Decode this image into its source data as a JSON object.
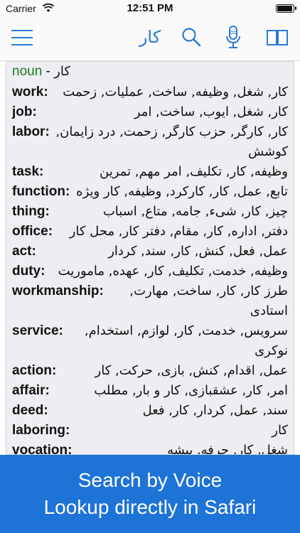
{
  "status": {
    "carrier": "Carrier",
    "time": "12:51 PM",
    "battery_level": 0.95
  },
  "nav": {
    "title": "کار",
    "menu_icon": "hamburger-menu-icon",
    "search_icon": "search-icon",
    "mic_icon": "microphone-icon",
    "book_icon": "book-icon"
  },
  "entry": {
    "pos": "noun",
    "pos_dash": " - ",
    "headword": "کار"
  },
  "rows": [
    {
      "word": "work",
      "trans": "کار, شغل, وظیفه, ساخت, عملیات, زحمت"
    },
    {
      "word": "job",
      "trans": "کار, شغل, ایوب, ساخت, امر"
    },
    {
      "word": "labor",
      "trans": "کار, کارگر, حزب کارگر, زحمت, درد زایمان, کوشش"
    },
    {
      "word": "task",
      "trans": "وظیفه, کار, تکلیف, امر مهم, تمرین"
    },
    {
      "word": "function",
      "trans": "تابع, عمل, کار, کارکرد, وظیفه, کار ویژه"
    },
    {
      "word": "thing",
      "trans": "چیز, کار, شیء, جامه, متاع, اسباب"
    },
    {
      "word": "office",
      "trans": "دفتر, اداره, کار, مقام, دفتر کار, محل کار"
    },
    {
      "word": "act",
      "trans": "عمل, فعل, کنش, کار, سند, کردار"
    },
    {
      "word": "duty",
      "trans": "وظیفه, خدمت, تکلیف, کار, عهده, ماموریت"
    },
    {
      "word": "workmanship",
      "trans": "طرز کار, کار, ساخت, مهارت, استادی"
    },
    {
      "word": "service",
      "trans": "سرویس, خدمت, کار, لوازم, استخدام, نوکری"
    },
    {
      "word": "action",
      "trans": "عمل, اقدام, کنش, بازی, حرکت, کار"
    },
    {
      "word": "affair",
      "trans": "امر, کار, عشقبازی, کار و بار, مطلب"
    },
    {
      "word": "deed",
      "trans": "سند, عمل, کردار, کار, فعل"
    },
    {
      "word": "laboring",
      "trans": "کار"
    },
    {
      "word": "vocation",
      "trans": "شغل, کار, حرفه, پیشه"
    }
  ],
  "promo": {
    "line1": "Search by Voice",
    "line2": "Lookup directly in Safari"
  },
  "colors": {
    "accent": "#2a7bd6",
    "pos_green": "#1d7a1d",
    "promo_bg": "#1e73d7"
  }
}
